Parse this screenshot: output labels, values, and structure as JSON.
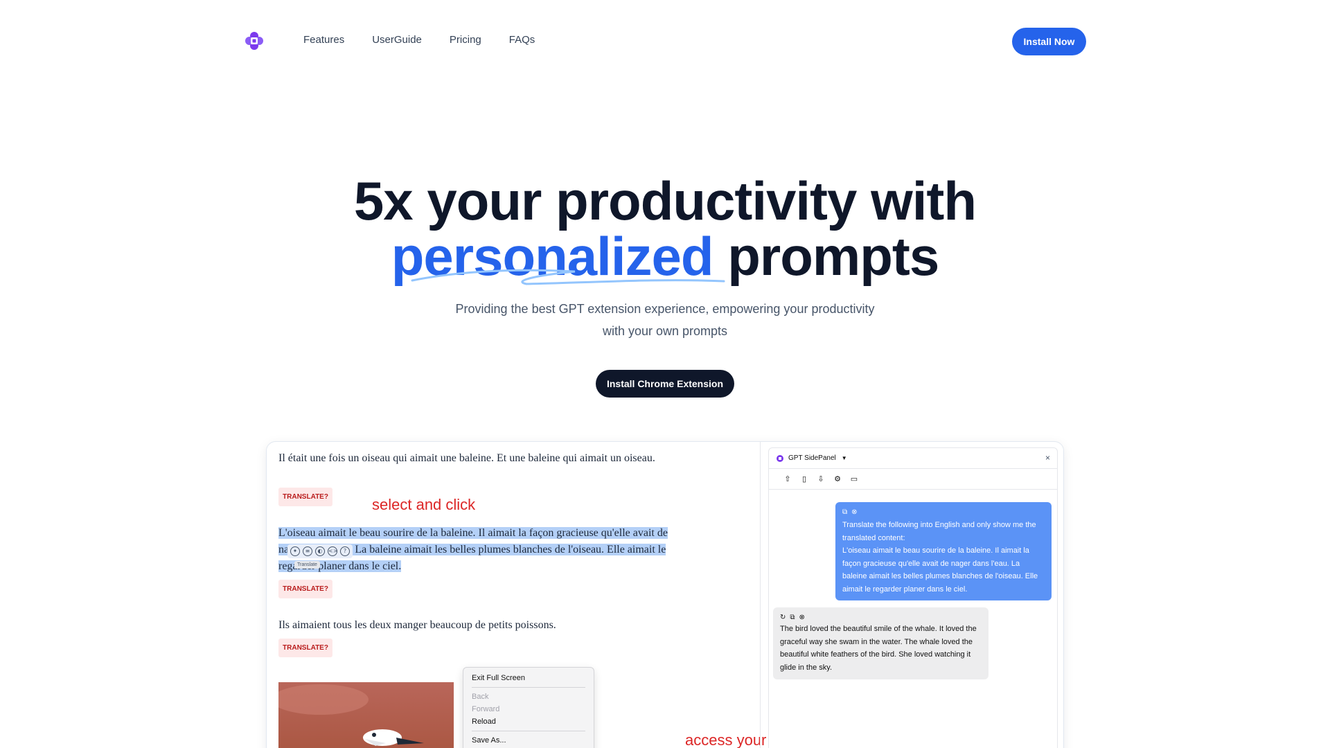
{
  "nav": {
    "links": [
      "Features",
      "UserGuide",
      "Pricing",
      "FAQs"
    ],
    "install_label": "Install Now"
  },
  "hero": {
    "line1": "5x your productivity with",
    "line2_highlight": "personalized",
    "line2_rest": " prompts",
    "subtitle_line1": "Providing the best GPT extension experience, empowering your productivity",
    "subtitle_line2": "with your own prompts",
    "cta_label": "Install Chrome Extension"
  },
  "demo": {
    "para1": "Il était une fois un oiseau qui aimait une baleine. Et une baleine qui aimait un oiseau.",
    "para2": "L'oiseau aimait le beau sourire de la baleine. Il aimait la façon gracieuse qu'elle avait de nager dans l'eau. La baleine aimait les belles plumes blanches de l'oiseau. Elle aimait le regarder planer dans le ciel.",
    "para3": "Ils aimaient tous les deux manger beaucoup de petits poissons.",
    "translate_label": "TRANSLATE?",
    "annotation_select": "select and click",
    "annotation_access": "access your personalized prompts !",
    "tooltip": "Translate",
    "context_menu": {
      "exit_full_screen": "Exit Full Screen",
      "back": "Back",
      "forward": "Forward",
      "reload": "Reload",
      "save_as": "Save As..."
    },
    "panel": {
      "title": "GPT SidePanel",
      "close": "×",
      "user_message": "Translate the following into English and only show me the translated content:\nL'oiseau aimait le beau sourire de la baleine. Il aimait la façon gracieuse qu'elle avait de nager dans l'eau. La baleine aimait les belles plumes blanches de l'oiseau. Elle aimait le regarder planer dans le ciel.",
      "bot_message": "The bird loved the beautiful smile of the whale. It loved the graceful way she swam in the water. The whale loved the beautiful white feathers of the bird. She loved watching it glide in the sky."
    }
  },
  "colors": {
    "accent": "#2563eb",
    "dark": "#0f172a",
    "annotation": "#dc2626",
    "logo": "#7c3aed"
  }
}
